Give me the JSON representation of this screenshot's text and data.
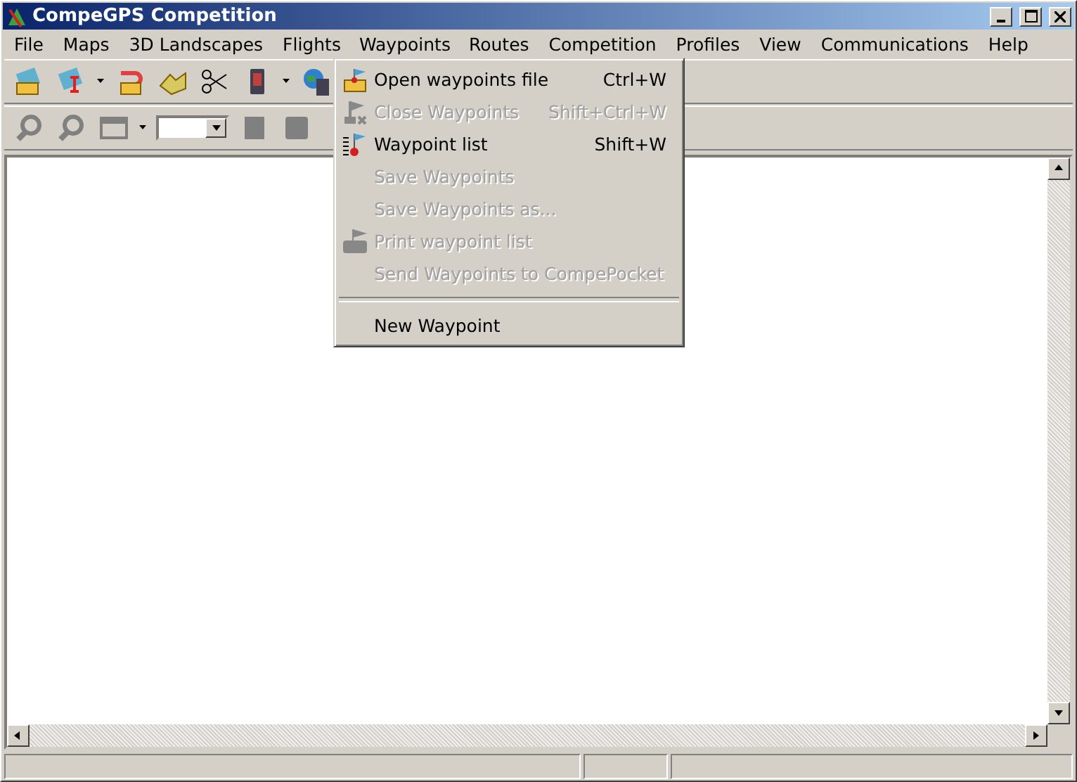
{
  "window": {
    "title": "CompeGPS Competition"
  },
  "menu_bar": [
    {
      "label": "File",
      "selected": false
    },
    {
      "label": "Maps",
      "selected": false
    },
    {
      "label": "3D Landscapes",
      "selected": false
    },
    {
      "label": "Flights",
      "selected": false
    },
    {
      "label": "Waypoints",
      "selected": true
    },
    {
      "label": "Routes",
      "selected": false
    },
    {
      "label": "Competition",
      "selected": false
    },
    {
      "label": "Profiles",
      "selected": false
    },
    {
      "label": "View",
      "selected": false
    },
    {
      "label": "Communications",
      "selected": false
    },
    {
      "label": "Help",
      "selected": false
    }
  ],
  "dropdown": [
    {
      "kind": "item",
      "label": "Open waypoints file",
      "shortcut": "Ctrl+W",
      "disabled": false
    },
    {
      "kind": "item",
      "label": "Close Waypoints",
      "shortcut": "Shift+Ctrl+W",
      "disabled": true
    },
    {
      "kind": "item",
      "label": "Waypoint list",
      "shortcut": "Shift+W",
      "disabled": false
    },
    {
      "kind": "item",
      "label": "Save Waypoints",
      "disabled": true
    },
    {
      "kind": "item",
      "label": "Save Waypoints as...",
      "disabled": true
    },
    {
      "kind": "item",
      "label": "Print waypoint list",
      "disabled": true
    },
    {
      "kind": "item",
      "label": "Send Waypoints to CompePocket",
      "disabled": true
    },
    {
      "kind": "separator"
    },
    {
      "kind": "item",
      "label": "New Waypoint",
      "disabled": false
    }
  ]
}
